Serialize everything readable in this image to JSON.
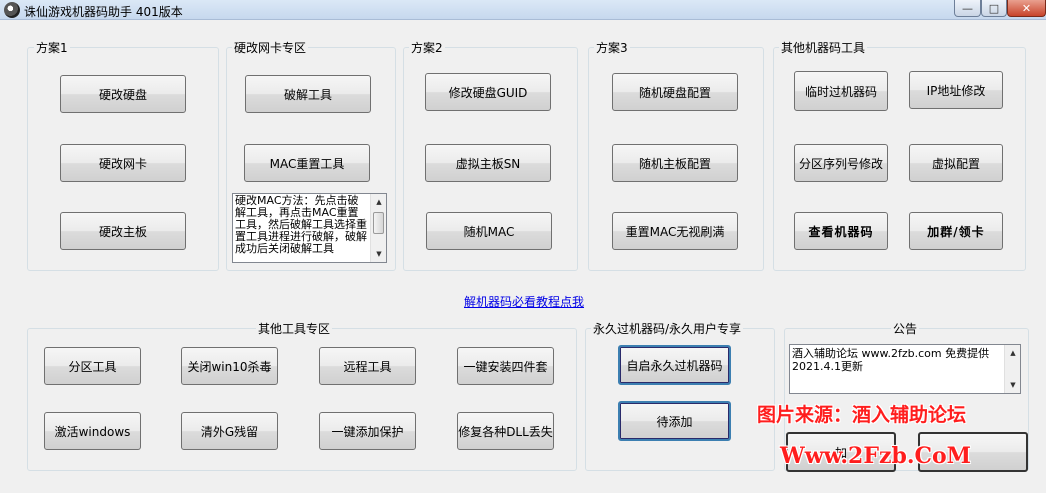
{
  "window": {
    "title": "诛仙游戏机器码助手  401版本",
    "controls": {
      "minimize": "—",
      "maximize": "□",
      "close": "✕"
    }
  },
  "plan1": {
    "label": "方案1",
    "buttons": [
      "硬改硬盘",
      "硬改网卡",
      "硬改主板"
    ]
  },
  "nic": {
    "label": "硬改网卡专区",
    "buttons": [
      "破解工具",
      "MAC重置工具"
    ],
    "memo": "硬改MAC方法：先点击破解工具，再点击MAC重置工具，然后破解工具选择重置工具进程进行破解，破解成功后关闭破解工具"
  },
  "plan2": {
    "label": "方案2",
    "buttons": [
      "修改硬盘GUID",
      "虚拟主板SN",
      "随机MAC"
    ]
  },
  "plan3": {
    "label": "方案3",
    "buttons": [
      "随机硬盘配置",
      "随机主板配置",
      "重置MAC无视刷满"
    ]
  },
  "other_machine": {
    "label": "其他机器码工具",
    "buttons": [
      "临时过机器码",
      "IP地址修改",
      "分区序列号修改",
      "虚拟配置",
      "查看机器码",
      "加群/领卡"
    ]
  },
  "tutorial_link": "解机器码必看教程点我",
  "other_tools": {
    "label": "其他工具专区",
    "buttons": [
      "分区工具",
      "关闭win10杀毒",
      "远程工具",
      "一键安装四件套",
      "激活windows",
      "清外G残留",
      "一键添加保护",
      "修复各种DLL丢失"
    ]
  },
  "permanent": {
    "label": "永久过机器码/永久用户专享",
    "buttons": [
      "自启永久过机器码",
      "待添加"
    ]
  },
  "notice": {
    "label": "公告",
    "text": "酒入辅助论坛 www.2fzb.com 免费提供\n2021.4.1更新",
    "bottom_buttons": [
      "加",
      ""
    ]
  },
  "watermark": {
    "line1": "图片来源：酒入辅助论坛",
    "line2": "Www.2Fzb.CoM",
    "color": "#ff1e1e"
  }
}
